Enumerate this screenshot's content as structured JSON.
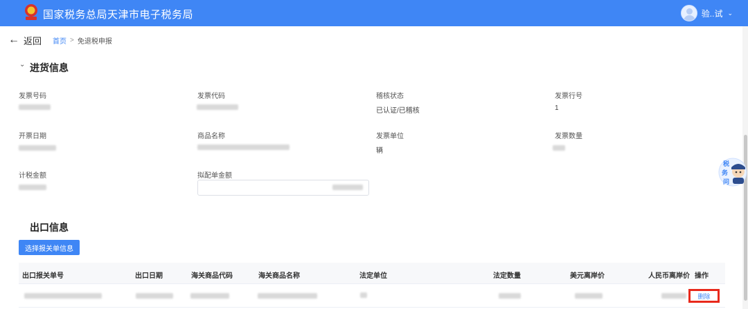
{
  "header": {
    "title": "国家税务总局天津市电子税务局",
    "user_name": "验..试",
    "caret": "⌄"
  },
  "nav": {
    "back_arrow": "←",
    "back_label": "返回",
    "breadcrumb_home": "首页",
    "breadcrumb_separator": ">",
    "breadcrumb_current": "免退税申报"
  },
  "purchase_section": {
    "title": "进货信息",
    "toggle": "⌄",
    "fields": {
      "invoice_number": {
        "label": "发票号码"
      },
      "invoice_code": {
        "label": "发票代码"
      },
      "audit_status": {
        "label": "稽核状态",
        "value": "已认证/已稽核"
      },
      "invoice_line": {
        "label": "发票行号",
        "value": "1"
      },
      "issue_date": {
        "label": "开票日期"
      },
      "product_name": {
        "label": "商品名称"
      },
      "invoice_unit": {
        "label": "发票单位",
        "value": "辆"
      },
      "invoice_quantity": {
        "label": "发票数量"
      },
      "taxable_amount": {
        "label": "计税金额"
      },
      "allocated_amount": {
        "label": "拟配单金额"
      }
    }
  },
  "export_section": {
    "title": "出口信息",
    "select_button": "选择报关单信息",
    "table": {
      "columns": [
        "出口报关单号",
        "出口日期",
        "海关商品代码",
        "海关商品名称",
        "法定单位",
        "法定数量",
        "美元离岸价",
        "人民币离岸价",
        "操作"
      ],
      "row_action": "删除"
    }
  },
  "mascot": {
    "line1": "税",
    "line2": "务",
    "line3": "问"
  },
  "colors": {
    "brand": "#3f86f5",
    "highlight": "#e8291c"
  }
}
